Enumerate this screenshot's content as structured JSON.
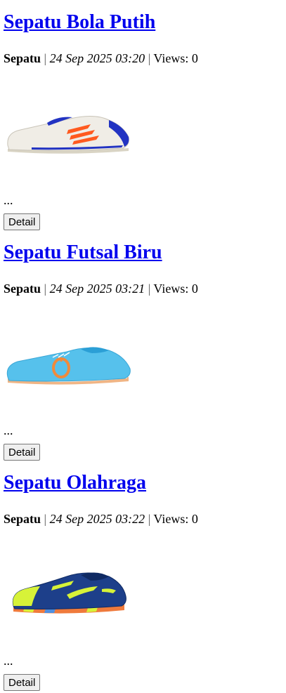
{
  "posts": [
    {
      "title": "Sepatu Bola Putih",
      "category": "Sepatu",
      "separator": "|",
      "date": "24 Sep 2025 03:20",
      "views_label": "Views: 0",
      "excerpt": "...",
      "button_label": "Detail",
      "image": "white-football-boot-image",
      "colors": {
        "body": "#f0ede6",
        "stripe": "#ff5a1f",
        "accent": "#2233c2",
        "sole": "#d9d4c4"
      }
    },
    {
      "title": "Sepatu Futsal Biru",
      "category": "Sepatu",
      "separator": "|",
      "date": "24 Sep 2025 03:21",
      "views_label": "Views: 0",
      "excerpt": "...",
      "button_label": "Detail",
      "image": "blue-futsal-shoe-image",
      "colors": {
        "body": "#56c1ec",
        "stripe": "#f08a3c",
        "accent": "#2b9fd6",
        "sole": "#f0b585"
      }
    },
    {
      "title": "Sepatu Olahraga",
      "category": "Sepatu",
      "separator": "|",
      "date": "24 Sep 2025 03:22",
      "views_label": "Views: 0",
      "excerpt": "...",
      "button_label": "Detail",
      "image": "navy-sport-shoe-image",
      "colors": {
        "body": "#1d3f8a",
        "stripe": "#d7f238",
        "accent": "#0f2a63",
        "sole": "#ef7a3c"
      }
    }
  ]
}
